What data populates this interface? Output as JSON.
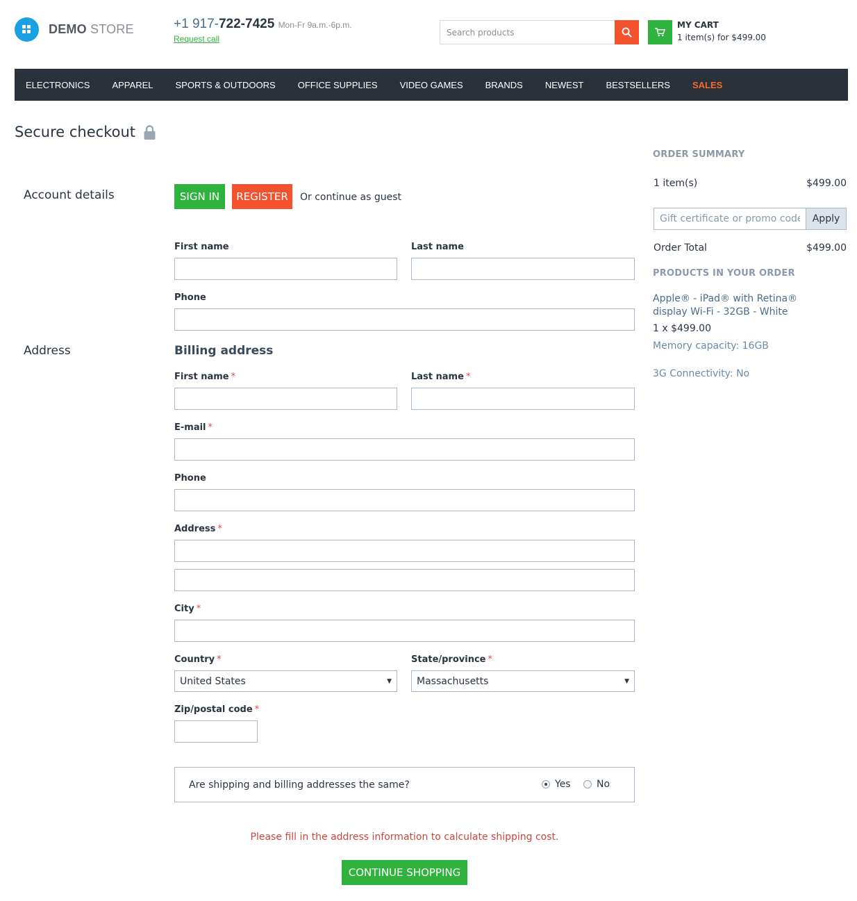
{
  "header": {
    "logo": {
      "bold": "DEMO",
      "light": " STORE"
    },
    "phone": {
      "prefix": "+1 917-",
      "number": "722-7425",
      "hours": "Mon-Fr 9a.m.-6p.m.",
      "request_call": "Request call"
    },
    "search": {
      "placeholder": "Search products"
    },
    "cart": {
      "title": "MY CART",
      "summary": "1 item(s) for $499.00"
    }
  },
  "nav": {
    "items": [
      "ELECTRONICS",
      "APPAREL",
      "SPORTS & OUTDOORS",
      "OFFICE SUPPLIES",
      "VIDEO GAMES",
      "BRANDS",
      "NEWEST",
      "BESTSELLERS",
      "SALES"
    ]
  },
  "page_title": "Secure checkout",
  "account": {
    "section_label": "Account details",
    "sign_in": "SIGN IN",
    "register": "REGISTER",
    "guest_text": "Or continue as guest",
    "first_name_label": "First name",
    "last_name_label": "Last name",
    "phone_label": "Phone"
  },
  "address": {
    "section_label": "Address",
    "billing_heading": "Billing address",
    "first_name_label": "First name",
    "last_name_label": "Last name",
    "email_label": "E-mail",
    "phone_label": "Phone",
    "address_label": "Address",
    "city_label": "City",
    "country_label": "Country",
    "country_value": "United States",
    "state_label": "State/province",
    "state_value": "Massachusetts",
    "zip_label": "Zip/postal code",
    "required_mark": "*",
    "same_question": "Are shipping and billing addresses the same?",
    "yes_label": "Yes",
    "no_label": "No",
    "same_selected": "Yes"
  },
  "shipping_warning": "Please fill in the address information to calculate shipping cost.",
  "continue_shopping": "CONTINUE SHOPPING",
  "summary": {
    "heading": "ORDER SUMMARY",
    "items_label": "1 item(s)",
    "items_value": "$499.00",
    "promo_placeholder": "Gift certificate or promo code",
    "apply": "Apply",
    "total_label": "Order Total",
    "total_value": "$499.00",
    "products_heading": "PRODUCTS IN YOUR ORDER",
    "product": {
      "name": "Apple® - iPad® with Retina® display Wi-Fi - 32GB - White",
      "qty_price": "1 x $499.00",
      "options": [
        "Memory capacity: 16GB",
        "3G Connectivity: No"
      ]
    }
  },
  "colors": {
    "nav_bg": "#2a313b",
    "green": "#2fb33e",
    "red": "#f2522e",
    "sales": "#f26b2b",
    "logo": "#1aa1e1"
  }
}
